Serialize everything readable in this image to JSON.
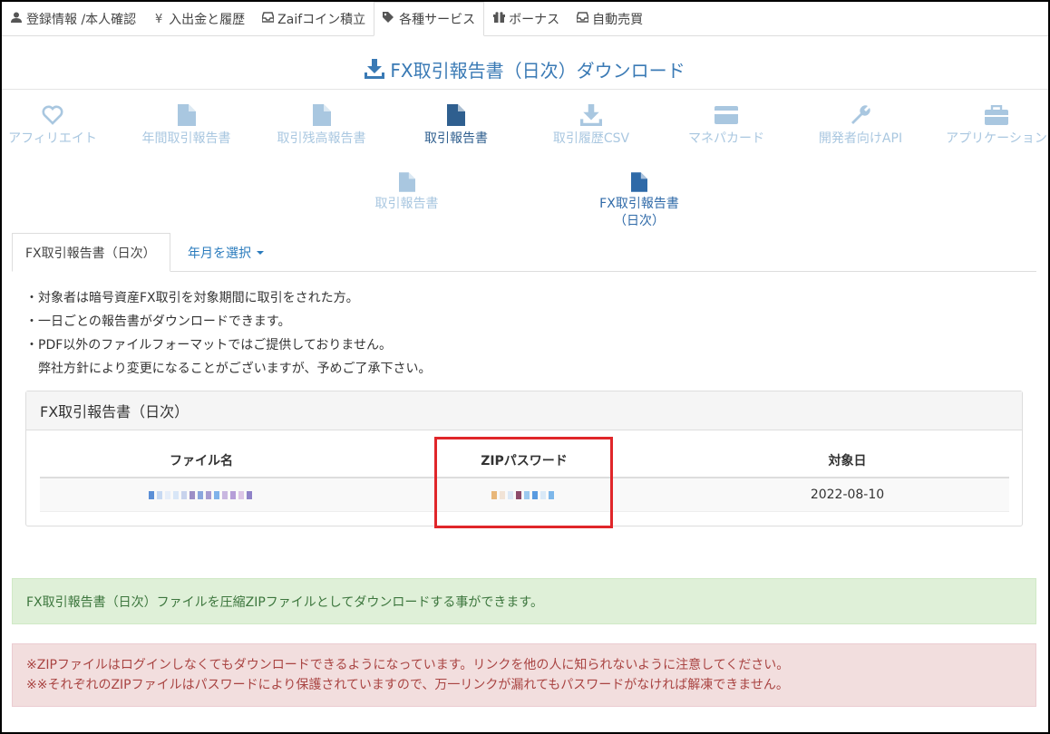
{
  "topnav": [
    {
      "label": "登録情報 /本人確認",
      "icon": "user-icon"
    },
    {
      "label": "入出金と履歴",
      "icon": "yen-icon"
    },
    {
      "label": "Zaifコイン積立",
      "icon": "inbox-icon"
    },
    {
      "label": "各種サービス",
      "icon": "tags-icon",
      "active": true
    },
    {
      "label": "ボーナス",
      "icon": "gift-icon"
    },
    {
      "label": "自動売買",
      "icon": "inbox-icon"
    }
  ],
  "title": "FX取引報告書（日次）ダウンロード",
  "services": [
    {
      "label": "アフィリエイト",
      "icon": "heart-icon"
    },
    {
      "label": "年間取引報告書",
      "icon": "file-icon"
    },
    {
      "label": "取引残高報告書",
      "icon": "file-icon"
    },
    {
      "label": "取引報告書",
      "icon": "file-icon",
      "active": true
    },
    {
      "label": "取引履歴CSV",
      "icon": "download-icon"
    },
    {
      "label": "マネパカード",
      "icon": "credit-card-icon"
    },
    {
      "label": "開発者向けAPI",
      "icon": "wrench-icon"
    },
    {
      "label": "アプリケーション",
      "icon": "briefcase-icon"
    }
  ],
  "subservices": [
    {
      "label": "取引報告書",
      "icon": "file-icon"
    },
    {
      "label_line1": "FX取引報告書",
      "label_line2": "（日次）",
      "icon": "file-icon",
      "active": true
    }
  ],
  "tabs": {
    "active_label": "FX取引報告書（日次）",
    "dropdown_label": "年月を選択"
  },
  "notes": [
    "・対象者は暗号資産FX取引を対象期間に取引をされた方。",
    "・一日ごとの報告書がダウンロードできます。",
    "・PDF以外のファイルフォーマットではご提供しておりません。",
    "　弊社方針により変更になることがございますが、予めご了承下さい。"
  ],
  "panel": {
    "title": "FX取引報告書（日次）",
    "columns": [
      "ファイル名",
      "ZIPパスワード",
      "対象日"
    ],
    "rows": [
      {
        "filename": "",
        "password": "",
        "date": "2022-08-10"
      }
    ]
  },
  "alerts": {
    "success": "FX取引報告書（日次）ファイルを圧縮ZIPファイルとしてダウンロードする事ができます。",
    "danger_line1": "※ZIPファイルはログインしなくてもダウンロードできるようになっています。リンクを他の人に知られないように注意してください。",
    "danger_line2": "※※それぞれのZIPファイルはパスワードにより保護されていますので、万一リンクが漏れてもパスワードがなければ解凍できません。"
  },
  "colors": {
    "accent": "#3a7ab5",
    "icon_inactive": "#a9c7e0",
    "highlight": "#e0262a",
    "success_bg": "#dff0d8",
    "danger_bg": "#f2dede"
  }
}
